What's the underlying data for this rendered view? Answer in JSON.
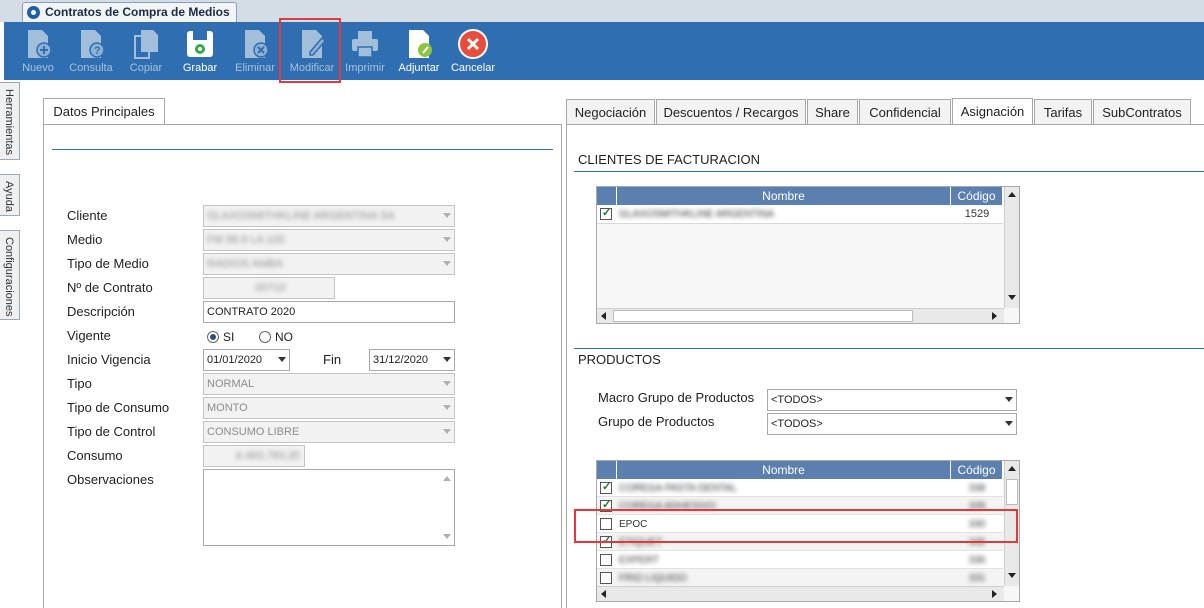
{
  "window": {
    "tab_title": "Contratos de Compra de Medios"
  },
  "toolbar": {
    "buttons": [
      {
        "label": "Nuevo",
        "icon": "document-add-icon",
        "enabled": false
      },
      {
        "label": "Consulta",
        "icon": "document-question-icon",
        "enabled": false
      },
      {
        "label": "Copiar",
        "icon": "copy-icon",
        "enabled": false
      },
      {
        "label": "Grabar",
        "icon": "floppy-save-icon",
        "enabled": true
      },
      {
        "label": "Eliminar",
        "icon": "document-delete-icon",
        "enabled": false
      },
      {
        "label": "Modificar",
        "icon": "document-edit-icon",
        "enabled": false
      },
      {
        "label": "Imprimir",
        "icon": "printer-icon",
        "enabled": false
      },
      {
        "label": "Adjuntar",
        "icon": "attach-icon",
        "enabled": true
      },
      {
        "label": "Cancelar",
        "icon": "cancel-icon",
        "enabled": true
      }
    ]
  },
  "side_tabs": [
    "Herramientas",
    "Ayuda",
    "Configuraciones"
  ],
  "left_panel": {
    "tab": "Datos Principales",
    "labels": {
      "cliente": "Cliente",
      "medio": "Medio",
      "tipo_medio": "Tipo de Medio",
      "nro_contrato": "Nº de Contrato",
      "descripcion": "Descripción",
      "vigente": "Vigente",
      "inicio_vigencia": "Inicio Vigencia",
      "fin": "Fin",
      "tipo": "Tipo",
      "tipo_consumo": "Tipo de Consumo",
      "tipo_control": "Tipo de Control",
      "consumo": "Consumo",
      "observaciones": "Observaciones"
    },
    "values": {
      "cliente": "GLAXOSMITHKLINE ARGENTINA SA",
      "medio": "FM 99.9 LA 100",
      "tipo_medio": "RADIOS AMBA",
      "nro_contrato": "00710",
      "descripcion": "CONTRATO 2020",
      "vigente_si": "SI",
      "vigente_no": "NO",
      "inicio_vigencia": "01/01/2020",
      "fin": "31/12/2020",
      "tipo": "NORMAL",
      "tipo_consumo": "MONTO",
      "tipo_control": "CONSUMO LIBRE",
      "consumo": "6.463.783,35",
      "observaciones": ""
    }
  },
  "right_panel": {
    "tabs": [
      "Negociación",
      "Descuentos / Recargos",
      "Share",
      "Confidencial",
      "Asignación",
      "Tarifas",
      "SubContratos"
    ],
    "active_tab": "Asignación",
    "clientes": {
      "title": "CLIENTES DE FACTURACION",
      "col_nombre": "Nombre",
      "col_codigo": "Código",
      "rows": [
        {
          "checked": true,
          "nombre": "GLAXOSMITHKLINE ARGENTINA",
          "codigo": "1529"
        }
      ]
    },
    "productos": {
      "title": "PRODUCTOS",
      "macro_label": "Macro Grupo de Productos",
      "macro_value": "<TODOS>",
      "grupo_label": "Grupo de Productos",
      "grupo_value": "<TODOS>",
      "col_nombre": "Nombre",
      "col_codigo": "Código",
      "rows": [
        {
          "checked": true,
          "nombre": "COREGA PASTA DENTAL",
          "codigo": "338"
        },
        {
          "checked": true,
          "nombre": "COREGA ADHESIVO",
          "codigo": "339"
        },
        {
          "checked": false,
          "nombre": "EPOC",
          "codigo": "330"
        },
        {
          "checked": true,
          "nombre": "ETIQUET",
          "codigo": "335"
        },
        {
          "checked": false,
          "nombre": "EXPERT",
          "codigo": "336"
        },
        {
          "checked": false,
          "nombre": "FRIO LIQUIDO",
          "codigo": "331"
        }
      ]
    }
  },
  "colors": {
    "toolbar_bg": "#2f6fb1",
    "grid_header_bg": "#5b7fae",
    "highlight": "#e2393c"
  }
}
